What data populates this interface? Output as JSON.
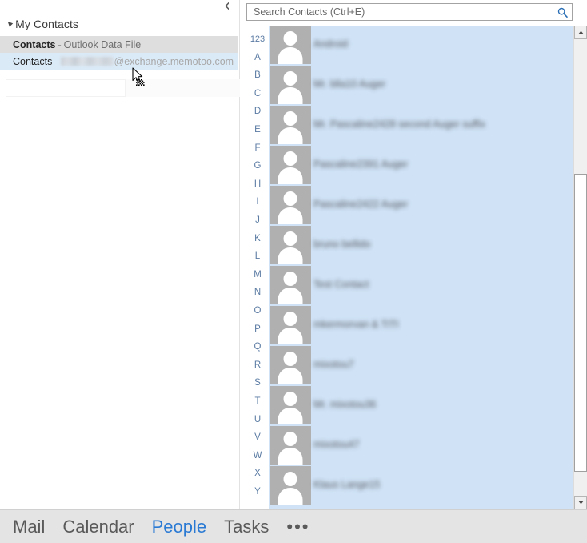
{
  "nav_pane": {
    "collapse_icon": "chevron-left-icon",
    "header": {
      "expand_icon": "triangle-down-icon",
      "title": "My Contacts"
    },
    "rows": [
      {
        "name": "Contacts",
        "separator": "-",
        "source": "Outlook Data File",
        "state": "hovered",
        "redacted": false
      },
      {
        "name": "Contacts",
        "separator": "-",
        "source": "@exchange.memotoo.com",
        "state": "selected",
        "redacted": true
      }
    ]
  },
  "search": {
    "placeholder": "Search Contacts (Ctrl+E)",
    "value": "",
    "icon": "search-icon"
  },
  "alpha_index": [
    "123",
    "A",
    "B",
    "C",
    "D",
    "E",
    "F",
    "G",
    "H",
    "I",
    "J",
    "K",
    "L",
    "M",
    "N",
    "O",
    "P",
    "Q",
    "R",
    "S",
    "T",
    "U",
    "V",
    "W",
    "X",
    "Y"
  ],
  "contacts": [
    {
      "name": "Android",
      "avatar": "person-placeholder-icon"
    },
    {
      "name": "Mr. blla10 Auger",
      "avatar": "person-placeholder-icon"
    },
    {
      "name": "Mr. Pascaline2428 second Auger suffix",
      "avatar": "person-placeholder-icon"
    },
    {
      "name": "Pascaline2391 Auger",
      "avatar": "person-placeholder-icon"
    },
    {
      "name": "Pascaline2422 Auger",
      "avatar": "person-placeholder-icon"
    },
    {
      "name": "bruno bellido",
      "avatar": "person-placeholder-icon"
    },
    {
      "name": "Test Contact",
      "avatar": "person-placeholder-icon"
    },
    {
      "name": "mkermorvan & TITI",
      "avatar": "person-placeholder-icon"
    },
    {
      "name": "mixotou7",
      "avatar": "person-placeholder-icon"
    },
    {
      "name": "Mr. mixotou36",
      "avatar": "person-placeholder-icon"
    },
    {
      "name": "mixotou47",
      "avatar": "person-placeholder-icon"
    },
    {
      "name": "Klaus Lange15",
      "avatar": "person-placeholder-icon"
    }
  ],
  "scrollbar": {
    "up_icon": "scroll-up-arrow-icon",
    "down_icon": "scroll-down-arrow-icon",
    "thumb": "scroll-thumb"
  },
  "module_bar": {
    "items": [
      {
        "label": "Mail",
        "active": false
      },
      {
        "label": "Calendar",
        "active": false
      },
      {
        "label": "People",
        "active": true
      },
      {
        "label": "Tasks",
        "active": false
      }
    ],
    "more_label": "•••",
    "accent_color": "#2a7ad4"
  },
  "cursor": {
    "icon": "arrow-busy-cursor"
  }
}
